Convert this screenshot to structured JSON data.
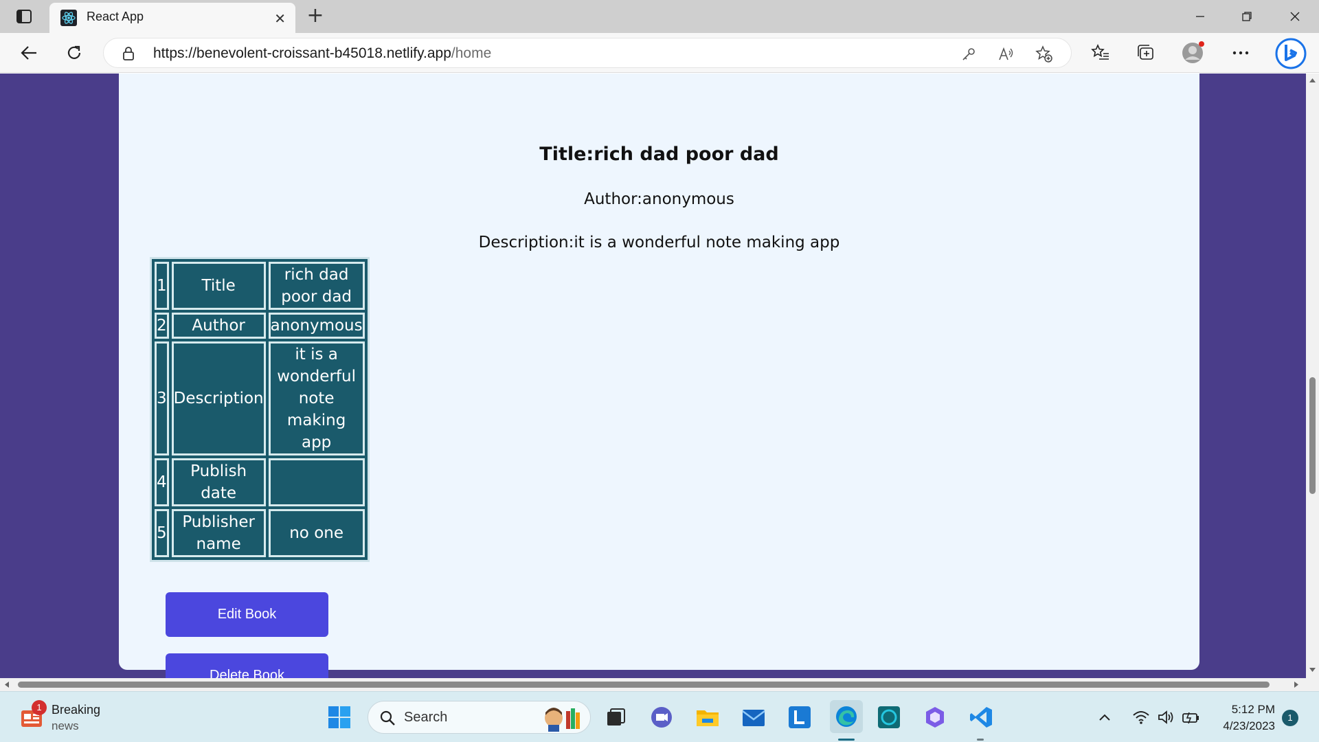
{
  "browser": {
    "tab_title": "React App",
    "url_host": "https://benevolent-croissant-b45018.netlify.app",
    "url_path": "/home"
  },
  "book": {
    "title_line": "Title:rich dad poor dad",
    "author_line": "Author:anonymous",
    "description_line": "Description:it is a wonderful note making app"
  },
  "table": {
    "rows": [
      {
        "index": "1",
        "key": "Title",
        "value": "rich dad poor dad"
      },
      {
        "index": "2",
        "key": "Author",
        "value": "anonymous"
      },
      {
        "index": "3",
        "key": "Description",
        "value": "it is a wonderful note making app"
      },
      {
        "index": "4",
        "key": "Publish date",
        "value": ""
      },
      {
        "index": "5",
        "key": "Publisher name",
        "value": "no one"
      }
    ]
  },
  "actions": {
    "edit_label": "Edit Book",
    "delete_label": "Delete Book"
  },
  "colors": {
    "page_background": "#4a3d8a",
    "card_background": "#eef6fe",
    "table_cell": "#1a5a6b",
    "button": "#4b47de"
  },
  "taskbar": {
    "news_title": "Breaking",
    "news_sub": "news",
    "news_badge": "1",
    "search_label": "Search",
    "time": "5:12 PM",
    "date": "4/23/2023",
    "notification_count": "1"
  }
}
